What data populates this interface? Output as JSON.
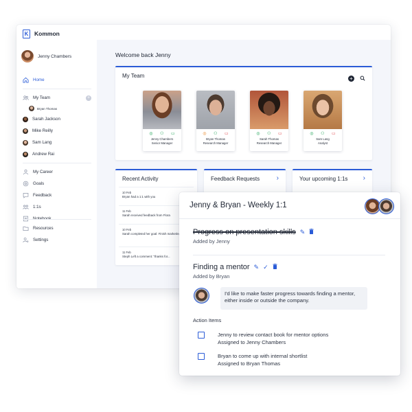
{
  "app": {
    "name": "Kommon",
    "logo_letter": "K"
  },
  "user": {
    "name": "Jenny Chambers"
  },
  "nav": {
    "home": "Home",
    "my_team": "My Team",
    "sub_member": "Bryan Thomas",
    "members": [
      "Sarah Jackson",
      "Mike Reilly",
      "Sam Lang",
      "Andrew Rai"
    ],
    "career": "My Career",
    "goals": "Goals",
    "feedback": "Feedback",
    "one_on_ones": "1:1s",
    "notebook": "Notebook",
    "resources": "Resources",
    "settings": "Settings"
  },
  "welcome": "Welcome back Jenny",
  "team_card": {
    "title": "My Team",
    "people": [
      {
        "name": "Jenny Chambers",
        "role": "Senior Manager"
      },
      {
        "name": "Bryan Thomas",
        "role": "Research Manager"
      },
      {
        "name": "Sarah Thomas",
        "role": "Research Manager"
      },
      {
        "name": "Sam Lang",
        "role": "Analyst"
      }
    ]
  },
  "recent_activity": {
    "title": "Recent Activity",
    "items": [
      {
        "date": "10 Feb",
        "text": "Bryan had a 1:1 with you"
      },
      {
        "date": "11 Feb",
        "text": "Sarah received feedback from Flora"
      },
      {
        "date": "10 Feb",
        "text": "Sarah completed her goal: Finish marketing report"
      },
      {
        "date": "11 Feb",
        "text": "Steph Left a comment: \"thanks for..."
      }
    ]
  },
  "feedback_requests": {
    "title": "Feedback Requests"
  },
  "upcoming": {
    "title": "Your upcoming 1:1s"
  },
  "meeting": {
    "title": "Jenny & Bryan - Weekly 1:1",
    "topics": [
      {
        "title": "Progress on presentation skills",
        "added_by": "Added by Jenny"
      },
      {
        "title": "Finding a mentor",
        "added_by": "Added by Bryan"
      }
    ],
    "comment": "I'd like to make faster progress towards finding a mentor, either inside or outside the company.",
    "action_items_label": "Action Items",
    "action_items": [
      {
        "text": "Jenny to review contact book for mentor options",
        "assigned": "Assigned to Jenny Chambers"
      },
      {
        "text": "Bryan to come up with internal shortlist",
        "assigned": "Assigned to Bryan Thomas"
      }
    ]
  },
  "colors": {
    "accent": "#2a5bd7",
    "background": "#f4f6fb",
    "green": "#23a55a",
    "orange": "#e9882a",
    "red": "#e0474c"
  }
}
